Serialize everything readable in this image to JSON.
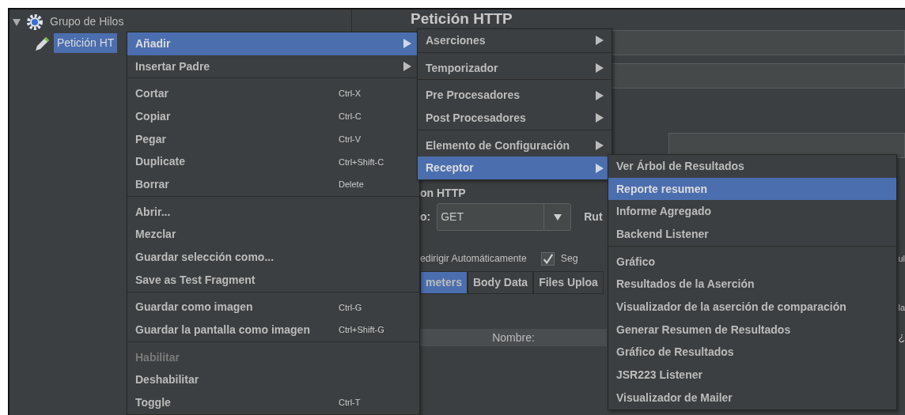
{
  "tree": [
    {
      "label": "Grupo de Hilos",
      "expanded": true,
      "selected": false,
      "children": [
        {
          "label": "Petición HT",
          "selected": true
        }
      ]
    }
  ],
  "panel": {
    "title": "Petición HTTP",
    "section": "on HTTP",
    "method_label": "o:",
    "method": "GET",
    "path_label": "Rut",
    "redirect_label": "edirigir Automáticamente",
    "follow_checked": true,
    "follow_label": "Seg",
    "edge_fragments": [
      "ul",
      "la",
      "¿"
    ],
    "tabs": [
      {
        "label": "meters",
        "selected": true
      },
      {
        "label": "Body Data",
        "selected": false
      },
      {
        "label": "Files Uploa",
        "selected": false
      }
    ],
    "table_header": "Nombre:"
  },
  "context_menu": [
    {
      "kind": "item",
      "label": "Añadir",
      "submenu": true,
      "selected": true,
      "disabled": false
    },
    {
      "kind": "item",
      "label": "Insertar Padre",
      "submenu": true,
      "selected": false,
      "disabled": false
    },
    {
      "kind": "separator"
    },
    {
      "kind": "item",
      "label": "Cortar",
      "shortcut": "Ctrl-X",
      "selected": false,
      "disabled": false
    },
    {
      "kind": "item",
      "label": "Copiar",
      "shortcut": "Ctrl-C",
      "selected": false,
      "disabled": false
    },
    {
      "kind": "item",
      "label": "Pegar",
      "shortcut": "Ctrl-V",
      "selected": false,
      "disabled": false
    },
    {
      "kind": "item",
      "label": "Duplicate",
      "shortcut": "Ctrl+Shift-C",
      "selected": false,
      "disabled": false
    },
    {
      "kind": "item",
      "label": "Borrar",
      "shortcut": "Delete",
      "selected": false,
      "disabled": false
    },
    {
      "kind": "separator"
    },
    {
      "kind": "item",
      "label": "Abrir...",
      "selected": false,
      "disabled": false
    },
    {
      "kind": "item",
      "label": "Mezclar",
      "selected": false,
      "disabled": false
    },
    {
      "kind": "item",
      "label": "Guardar selección como...",
      "selected": false,
      "disabled": false
    },
    {
      "kind": "item",
      "label": "Save as Test Fragment",
      "selected": false,
      "disabled": false
    },
    {
      "kind": "separator"
    },
    {
      "kind": "item",
      "label": "Guardar como imagen",
      "shortcut": "Ctrl-G",
      "selected": false,
      "disabled": false
    },
    {
      "kind": "item",
      "label": "Guardar la pantalla como imagen",
      "shortcut": "Ctrl+Shift-G",
      "selected": false,
      "disabled": false
    },
    {
      "kind": "separator"
    },
    {
      "kind": "item",
      "label": "Habilitar",
      "selected": false,
      "disabled": true
    },
    {
      "kind": "item",
      "label": "Deshabilitar",
      "selected": false,
      "disabled": false
    },
    {
      "kind": "item",
      "label": "Toggle",
      "shortcut": "Ctrl-T",
      "selected": false,
      "disabled": false
    },
    {
      "kind": "separator"
    }
  ],
  "add_submenu": [
    {
      "kind": "item",
      "label": "Aserciones",
      "submenu": true,
      "selected": false
    },
    {
      "kind": "separator"
    },
    {
      "kind": "item",
      "label": "Temporizador",
      "submenu": true,
      "selected": false
    },
    {
      "kind": "separator"
    },
    {
      "kind": "item",
      "label": "Pre Procesadores",
      "submenu": true,
      "selected": false
    },
    {
      "kind": "item",
      "label": "Post Procesadores",
      "submenu": true,
      "selected": false
    },
    {
      "kind": "separator"
    },
    {
      "kind": "item",
      "label": "Elemento de Configuración",
      "submenu": true,
      "selected": false
    },
    {
      "kind": "item",
      "label": "Receptor",
      "submenu": true,
      "selected": true
    }
  ],
  "listener_submenu": [
    {
      "kind": "item",
      "label": "Ver Árbol de Resultados",
      "selected": false
    },
    {
      "kind": "item",
      "label": "Reporte resumen",
      "selected": true
    },
    {
      "kind": "item",
      "label": "Informe Agregado",
      "selected": false
    },
    {
      "kind": "item",
      "label": "Backend Listener",
      "selected": false
    },
    {
      "kind": "separator"
    },
    {
      "kind": "item",
      "label": "Gráfico",
      "selected": false
    },
    {
      "kind": "item",
      "label": "Resultados de la Aserción",
      "selected": false
    },
    {
      "kind": "item",
      "label": "Visualizador de la aserción de comparación",
      "selected": false
    },
    {
      "kind": "item",
      "label": "Generar Resumen de Resultados",
      "selected": false
    },
    {
      "kind": "item",
      "label": "Gráfico de Resultados",
      "selected": false
    },
    {
      "kind": "item",
      "label": "JSR223 Listener",
      "selected": false
    },
    {
      "kind": "item",
      "label": "Visualizador de Mailer",
      "selected": false
    }
  ]
}
